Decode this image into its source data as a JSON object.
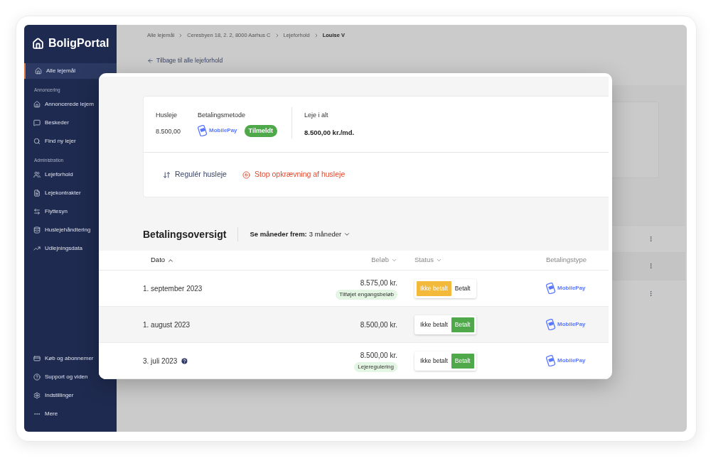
{
  "sidebar": {
    "logo": "BoligPortal",
    "top_item": {
      "label": "Alle lejemål",
      "selected": true
    },
    "sections": [
      {
        "heading": "Annoncering",
        "items": [
          {
            "label": "Annoncerede lejem",
            "selected": false
          },
          {
            "label": "Beskeder",
            "selected": false
          },
          {
            "label": "Find ny lejer",
            "selected": false
          }
        ]
      },
      {
        "heading": "Administration",
        "items": [
          {
            "label": "Lejeforhold",
            "selected": false
          },
          {
            "label": "Lejekontrakter",
            "selected": false
          },
          {
            "label": "Flyttesyn",
            "selected": false
          },
          {
            "label": "Huslejehåndtering",
            "selected": false
          },
          {
            "label": "Udlejningsdata",
            "selected": false
          }
        ]
      }
    ],
    "bottom_items": [
      {
        "label": "Køb og abonnemer",
        "selected": false
      },
      {
        "label": "Support og viden",
        "selected": false
      },
      {
        "label": "Indstillinger",
        "selected": false
      },
      {
        "label": "Mere",
        "selected": false
      }
    ]
  },
  "breadcrumb": [
    {
      "label": "Alle lejemål",
      "current": false
    },
    {
      "label": "Ceresbyen 18, 2. 2, 8000 Aarhus C",
      "current": false
    },
    {
      "label": "Lejeforhold",
      "current": false
    },
    {
      "label": "Louise V",
      "current": true
    }
  ],
  "back_link": "Tilbage til alle lejeforhold",
  "background_rows": [
    {
      "kind": "menu"
    },
    {
      "kind": "menu"
    },
    {
      "kind": "menu"
    }
  ],
  "modal": {
    "summary": {
      "rent_label": "Husleje",
      "rent_value": "8.500,00",
      "method_label": "Betalingsmetode",
      "method_logo": "MobilePay",
      "method_status": "Tilmeldt",
      "total_label": "Leje i alt",
      "total_value": "8.500,00 kr./md."
    },
    "actions": [
      {
        "label": "Regulér husleje",
        "kind": "adjust"
      },
      {
        "label": "Stop opkrævning af husleje",
        "kind": "stop"
      }
    ],
    "overview": {
      "title": "Betalingsoversigt",
      "filter_label": "Se måneder frem:",
      "filter_value": "3 måneder"
    },
    "table": {
      "columns": [
        {
          "label": "Dato",
          "sortable": true,
          "sorted": true
        },
        {
          "label": "Beløb",
          "sortable": true,
          "sorted": false
        },
        {
          "label": "Status",
          "sortable": true,
          "sorted": false
        },
        {
          "label": "Betalingstype",
          "sortable": false,
          "sorted": false
        }
      ],
      "rows": [
        {
          "date": "1. september 2023",
          "help": false,
          "amount": "8.575,00 kr.",
          "tag": "Tilføjet engangsbeløb",
          "status": [
            {
              "label": "Ikke betalt",
              "kind": "unpaid",
              "selected": true
            },
            {
              "label": "Betalt",
              "kind": "paid",
              "selected": false
            }
          ],
          "payment_type": "MobilePay"
        },
        {
          "date": "1. august 2023",
          "help": false,
          "amount": "8.500,00 kr.",
          "status": [
            {
              "label": "Ikke betalt",
              "kind": "unpaid",
              "selected": false
            },
            {
              "label": "Betalt",
              "kind": "paid",
              "selected": true
            }
          ],
          "payment_type": "MobilePay"
        },
        {
          "date": "3. juli 2023",
          "help": true,
          "amount": "8.500,00 kr.",
          "tag": "Lejeregulering",
          "status": [
            {
              "label": "Ikke betalt",
              "kind": "unpaid",
              "selected": false
            },
            {
              "label": "Betalt",
              "kind": "paid",
              "selected": true
            }
          ],
          "payment_type": "MobilePay"
        }
      ]
    }
  }
}
